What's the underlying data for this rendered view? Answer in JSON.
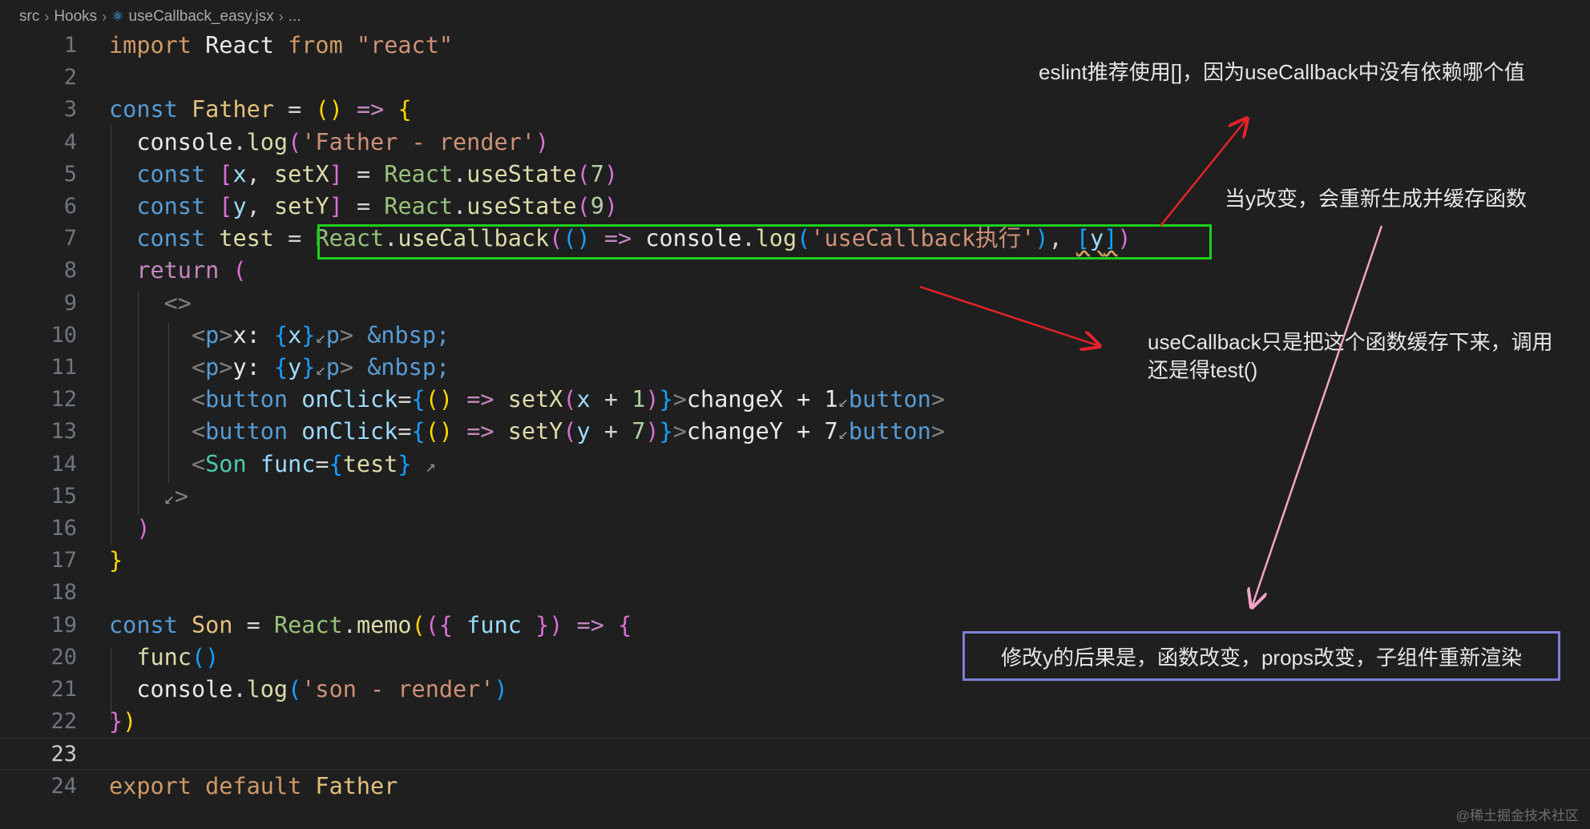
{
  "breadcrumb": [
    "src",
    "Hooks",
    "useCallback_easy.jsx",
    "..."
  ],
  "breadcrumb_file_icon": "react-icon",
  "editor": {
    "active_line": 23,
    "line_numbers": [
      "1",
      "2",
      "3",
      "4",
      "5",
      "6",
      "7",
      "8",
      "9",
      "10",
      "11",
      "12",
      "13",
      "14",
      "15",
      "16",
      "17",
      "18",
      "19",
      "20",
      "21",
      "22",
      "23",
      "24"
    ],
    "lines": [
      [
        [
          "kw",
          "import"
        ],
        [
          "p",
          " "
        ],
        [
          "plain",
          "React"
        ],
        [
          "p",
          " "
        ],
        [
          "kw",
          "from"
        ],
        [
          "p",
          " "
        ],
        [
          "str",
          "\"react\""
        ]
      ],
      [],
      [
        [
          "kw2",
          "const"
        ],
        [
          "p",
          " "
        ],
        [
          "var",
          "Father"
        ],
        [
          "p",
          " "
        ],
        [
          "op",
          "="
        ],
        [
          "p",
          " "
        ],
        [
          "b1",
          "()"
        ],
        [
          "p",
          " "
        ],
        [
          "arrow",
          "=>"
        ],
        [
          "p",
          " "
        ],
        [
          "b1",
          "{"
        ]
      ],
      [
        [
          "p",
          "  "
        ],
        [
          "plain",
          "console"
        ],
        [
          "punc",
          "."
        ],
        [
          "ident",
          "log"
        ],
        [
          "b2",
          "("
        ],
        [
          "str",
          "'Father - render'"
        ],
        [
          "b2",
          ")"
        ]
      ],
      [
        [
          "p",
          "  "
        ],
        [
          "kw2",
          "const"
        ],
        [
          "p",
          " "
        ],
        [
          "b2",
          "["
        ],
        [
          "attr",
          "x"
        ],
        [
          "punc",
          ","
        ],
        [
          "p",
          " "
        ],
        [
          "ident",
          "setX"
        ],
        [
          "b2",
          "]"
        ],
        [
          "p",
          " "
        ],
        [
          "op",
          "="
        ],
        [
          "p",
          " "
        ],
        [
          "obj",
          "React"
        ],
        [
          "punc",
          "."
        ],
        [
          "ident",
          "useState"
        ],
        [
          "b2",
          "("
        ],
        [
          "num",
          "7"
        ],
        [
          "b2",
          ")"
        ]
      ],
      [
        [
          "p",
          "  "
        ],
        [
          "kw2",
          "const"
        ],
        [
          "p",
          " "
        ],
        [
          "b2",
          "["
        ],
        [
          "attr",
          "y"
        ],
        [
          "punc",
          ","
        ],
        [
          "p",
          " "
        ],
        [
          "ident",
          "setY"
        ],
        [
          "b2",
          "]"
        ],
        [
          "p",
          " "
        ],
        [
          "op",
          "="
        ],
        [
          "p",
          " "
        ],
        [
          "obj",
          "React"
        ],
        [
          "punc",
          "."
        ],
        [
          "ident",
          "useState"
        ],
        [
          "b2",
          "("
        ],
        [
          "num",
          "9"
        ],
        [
          "b2",
          ")"
        ]
      ],
      [
        [
          "p",
          "  "
        ],
        [
          "kw2",
          "const"
        ],
        [
          "p",
          " "
        ],
        [
          "ident",
          "test"
        ],
        [
          "p",
          " "
        ],
        [
          "op",
          "="
        ],
        [
          "p",
          " "
        ],
        [
          "obj",
          "React"
        ],
        [
          "punc",
          "."
        ],
        [
          "ident",
          "useCallback"
        ],
        [
          "b2",
          "("
        ],
        [
          "b3",
          "()"
        ],
        [
          "p",
          " "
        ],
        [
          "arrow",
          "=>"
        ],
        [
          "p",
          " "
        ],
        [
          "plain",
          "console"
        ],
        [
          "punc",
          "."
        ],
        [
          "ident",
          "log"
        ],
        [
          "b3",
          "("
        ],
        [
          "str",
          "'useCallback执行'"
        ],
        [
          "b3",
          ")"
        ],
        [
          "punc",
          ","
        ],
        [
          "p",
          " "
        ],
        [
          "b3s",
          "["
        ],
        [
          "attrs",
          "y"
        ],
        [
          "b3s",
          "]"
        ],
        [
          "b2",
          ")"
        ]
      ],
      [
        [
          "p",
          "  "
        ],
        [
          "kwc",
          "return"
        ],
        [
          "p",
          " "
        ],
        [
          "b2",
          "("
        ]
      ],
      [
        [
          "p",
          "    "
        ],
        [
          "tagb",
          "<>"
        ]
      ],
      [
        [
          "p",
          "      "
        ],
        [
          "tagb",
          "<"
        ],
        [
          "tag",
          "p"
        ],
        [
          "tagb",
          ">"
        ],
        [
          "plain",
          "x: "
        ],
        [
          "b3",
          "{"
        ],
        [
          "attr",
          "x"
        ],
        [
          "b3",
          "}"
        ],
        [
          "hint",
          "↙"
        ],
        [
          "tag",
          "p"
        ],
        [
          "tagb",
          ">"
        ],
        [
          "p",
          " "
        ],
        [
          "ent",
          "&nbsp;"
        ]
      ],
      [
        [
          "p",
          "      "
        ],
        [
          "tagb",
          "<"
        ],
        [
          "tag",
          "p"
        ],
        [
          "tagb",
          ">"
        ],
        [
          "plain",
          "y: "
        ],
        [
          "b3",
          "{"
        ],
        [
          "attr",
          "y"
        ],
        [
          "b3",
          "}"
        ],
        [
          "hint",
          "↙"
        ],
        [
          "tag",
          "p"
        ],
        [
          "tagb",
          ">"
        ],
        [
          "p",
          " "
        ],
        [
          "ent",
          "&nbsp;"
        ]
      ],
      [
        [
          "p",
          "      "
        ],
        [
          "tagb",
          "<"
        ],
        [
          "tag",
          "button"
        ],
        [
          "p",
          " "
        ],
        [
          "attr",
          "onClick"
        ],
        [
          "op",
          "="
        ],
        [
          "b3",
          "{"
        ],
        [
          "b1",
          "()"
        ],
        [
          "p",
          " "
        ],
        [
          "arrow",
          "=>"
        ],
        [
          "p",
          " "
        ],
        [
          "ident",
          "setX"
        ],
        [
          "b2",
          "("
        ],
        [
          "attr",
          "x"
        ],
        [
          "p",
          " "
        ],
        [
          "op",
          "+"
        ],
        [
          "p",
          " "
        ],
        [
          "num",
          "1"
        ],
        [
          "b2",
          ")"
        ],
        [
          "b3",
          "}"
        ],
        [
          "tagb",
          ">"
        ],
        [
          "plain",
          "changeX + 1"
        ],
        [
          "hint",
          "↙"
        ],
        [
          "tag",
          "button"
        ],
        [
          "tagb",
          ">"
        ]
      ],
      [
        [
          "p",
          "      "
        ],
        [
          "tagb",
          "<"
        ],
        [
          "tag",
          "button"
        ],
        [
          "p",
          " "
        ],
        [
          "attr",
          "onClick"
        ],
        [
          "op",
          "="
        ],
        [
          "b3",
          "{"
        ],
        [
          "b1",
          "()"
        ],
        [
          "p",
          " "
        ],
        [
          "arrow",
          "=>"
        ],
        [
          "p",
          " "
        ],
        [
          "ident",
          "setY"
        ],
        [
          "b2",
          "("
        ],
        [
          "attr",
          "y"
        ],
        [
          "p",
          " "
        ],
        [
          "op",
          "+"
        ],
        [
          "p",
          " "
        ],
        [
          "num",
          "7"
        ],
        [
          "b2",
          ")"
        ],
        [
          "b3",
          "}"
        ],
        [
          "tagb",
          ">"
        ],
        [
          "plain",
          "changeY + 7"
        ],
        [
          "hint",
          "↙"
        ],
        [
          "tag",
          "button"
        ],
        [
          "tagb",
          ">"
        ]
      ],
      [
        [
          "p",
          "      "
        ],
        [
          "tagb",
          "<"
        ],
        [
          "comp",
          "Son"
        ],
        [
          "p",
          " "
        ],
        [
          "attr",
          "func"
        ],
        [
          "op",
          "="
        ],
        [
          "b3",
          "{"
        ],
        [
          "ident",
          "test"
        ],
        [
          "b3",
          "}"
        ],
        [
          "p",
          " "
        ],
        [
          "hint",
          "↗"
        ]
      ],
      [
        [
          "p",
          "    "
        ],
        [
          "hint",
          "↙"
        ],
        [
          "tagb",
          ">"
        ]
      ],
      [
        [
          "p",
          "  "
        ],
        [
          "b2",
          ")"
        ]
      ],
      [
        [
          "b1",
          "}"
        ]
      ],
      [],
      [
        [
          "kw2",
          "const"
        ],
        [
          "p",
          " "
        ],
        [
          "var",
          "Son"
        ],
        [
          "p",
          " "
        ],
        [
          "op",
          "="
        ],
        [
          "p",
          " "
        ],
        [
          "obj",
          "React"
        ],
        [
          "punc",
          "."
        ],
        [
          "ident",
          "memo"
        ],
        [
          "b1",
          "("
        ],
        [
          "b2",
          "({"
        ],
        [
          "p",
          " "
        ],
        [
          "attr",
          "func"
        ],
        [
          "p",
          " "
        ],
        [
          "b2",
          "})"
        ],
        [
          "p",
          " "
        ],
        [
          "arrow",
          "=>"
        ],
        [
          "p",
          " "
        ],
        [
          "b2",
          "{"
        ]
      ],
      [
        [
          "p",
          "  "
        ],
        [
          "ident",
          "func"
        ],
        [
          "b3",
          "()"
        ]
      ],
      [
        [
          "p",
          "  "
        ],
        [
          "plain",
          "console"
        ],
        [
          "punc",
          "."
        ],
        [
          "ident",
          "log"
        ],
        [
          "b3",
          "("
        ],
        [
          "str",
          "'son - render'"
        ],
        [
          "b3",
          ")"
        ]
      ],
      [
        [
          "b2",
          "}"
        ],
        [
          "b1",
          ")"
        ]
      ],
      [],
      [
        [
          "kw",
          "export"
        ],
        [
          "p",
          " "
        ],
        [
          "kw",
          "default"
        ],
        [
          "p",
          " "
        ],
        [
          "var",
          "Father"
        ]
      ]
    ]
  },
  "annotations": {
    "eslint_note": "eslint推荐使用[]，因为useCallback中没有依赖哪个值",
    "y_change_note": "当y改变，会重新生成并缓存函数",
    "cache_note_line1": "useCallback只是把这个函数缓存下来，调用",
    "cache_note_line2": "还是得test()",
    "consequence_note": "修改y的后果是，函数改变，props改变，子组件重新渲染"
  },
  "colors": {
    "background": "#1f1f1f",
    "highlight_box": "#1ecf1e",
    "consequence_box": "#7d7fd6",
    "red_arrow": "#e5222b",
    "pink_arrow": "#f5a3c7"
  },
  "watermark": "@稀土掘金技术社区"
}
